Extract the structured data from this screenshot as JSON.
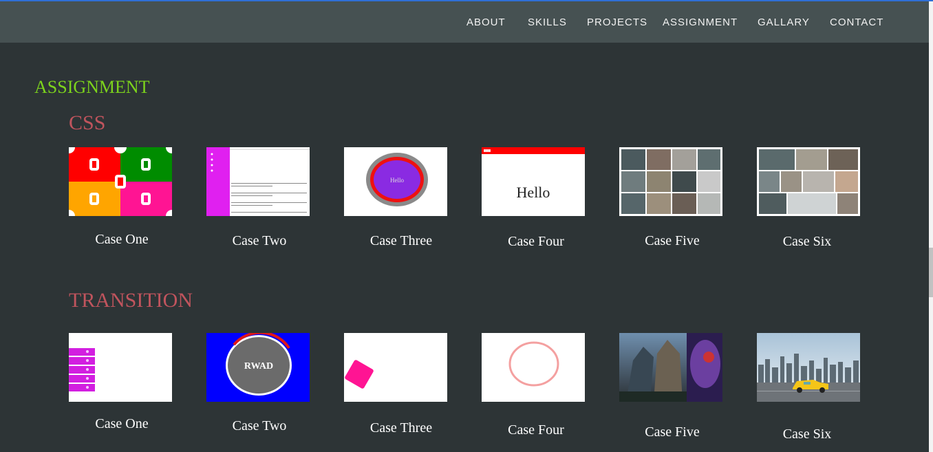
{
  "nav": {
    "about": "ABOUT",
    "skills": "SKILLS",
    "projects": "PROJECTS",
    "assignment": "ASSIGNMENT",
    "gallary": "GALLARY",
    "contact": "CONTACT"
  },
  "page": {
    "heading": "ASSIGNMENT"
  },
  "css_section": {
    "title": "CSS",
    "cards": [
      {
        "caption": "Case One"
      },
      {
        "caption": "Case Two"
      },
      {
        "caption": "Case Three",
        "thumb_text": "Hello"
      },
      {
        "caption": "Case Four",
        "thumb_text": "Hello"
      },
      {
        "caption": "Case Five"
      },
      {
        "caption": "Case Six"
      }
    ]
  },
  "transition_section": {
    "title": "TRANSITION",
    "cards": [
      {
        "caption": "Case One"
      },
      {
        "caption": "Case Two",
        "thumb_text": "RWAD"
      },
      {
        "caption": "Case Three"
      },
      {
        "caption": "Case Four"
      },
      {
        "caption": "Case Five"
      },
      {
        "caption": "Case Six"
      }
    ]
  },
  "colors": {
    "background": "#2d3436",
    "navbar": "#465152",
    "heading": "#7cd31c",
    "section_title": "#c0545d"
  }
}
